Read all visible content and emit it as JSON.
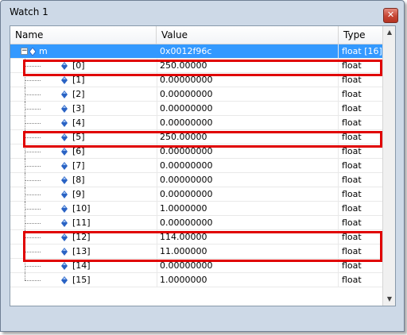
{
  "window": {
    "title": "Watch 1",
    "close_glyph": "✕"
  },
  "columns": {
    "name": "Name",
    "value": "Value",
    "type": "Type"
  },
  "root": {
    "name": "m",
    "value": "0x0012f96c",
    "type": "float [16]",
    "expander": "−"
  },
  "rows": [
    {
      "name": "[0]",
      "value": "250.00000",
      "type": "float"
    },
    {
      "name": "[1]",
      "value": "0.00000000",
      "type": "float"
    },
    {
      "name": "[2]",
      "value": "0.00000000",
      "type": "float"
    },
    {
      "name": "[3]",
      "value": "0.00000000",
      "type": "float"
    },
    {
      "name": "[4]",
      "value": "0.00000000",
      "type": "float"
    },
    {
      "name": "[5]",
      "value": "250.00000",
      "type": "float"
    },
    {
      "name": "[6]",
      "value": "0.00000000",
      "type": "float"
    },
    {
      "name": "[7]",
      "value": "0.00000000",
      "type": "float"
    },
    {
      "name": "[8]",
      "value": "0.00000000",
      "type": "float"
    },
    {
      "name": "[9]",
      "value": "0.00000000",
      "type": "float"
    },
    {
      "name": "[10]",
      "value": "1.0000000",
      "type": "float"
    },
    {
      "name": "[11]",
      "value": "0.00000000",
      "type": "float"
    },
    {
      "name": "[12]",
      "value": "114.00000",
      "type": "float"
    },
    {
      "name": "[13]",
      "value": "11.000000",
      "type": "float"
    },
    {
      "name": "[14]",
      "value": "0.00000000",
      "type": "float"
    },
    {
      "name": "[15]",
      "value": "1.0000000",
      "type": "float"
    }
  ],
  "scrollbar": {
    "up_glyph": "▲",
    "down_glyph": "▼"
  },
  "colors": {
    "selection": "#3399ff",
    "highlight": "#e00000",
    "icon": "#2a63c4"
  },
  "icons": {
    "variable": "variable-diamond-icon",
    "close": "close-icon"
  }
}
